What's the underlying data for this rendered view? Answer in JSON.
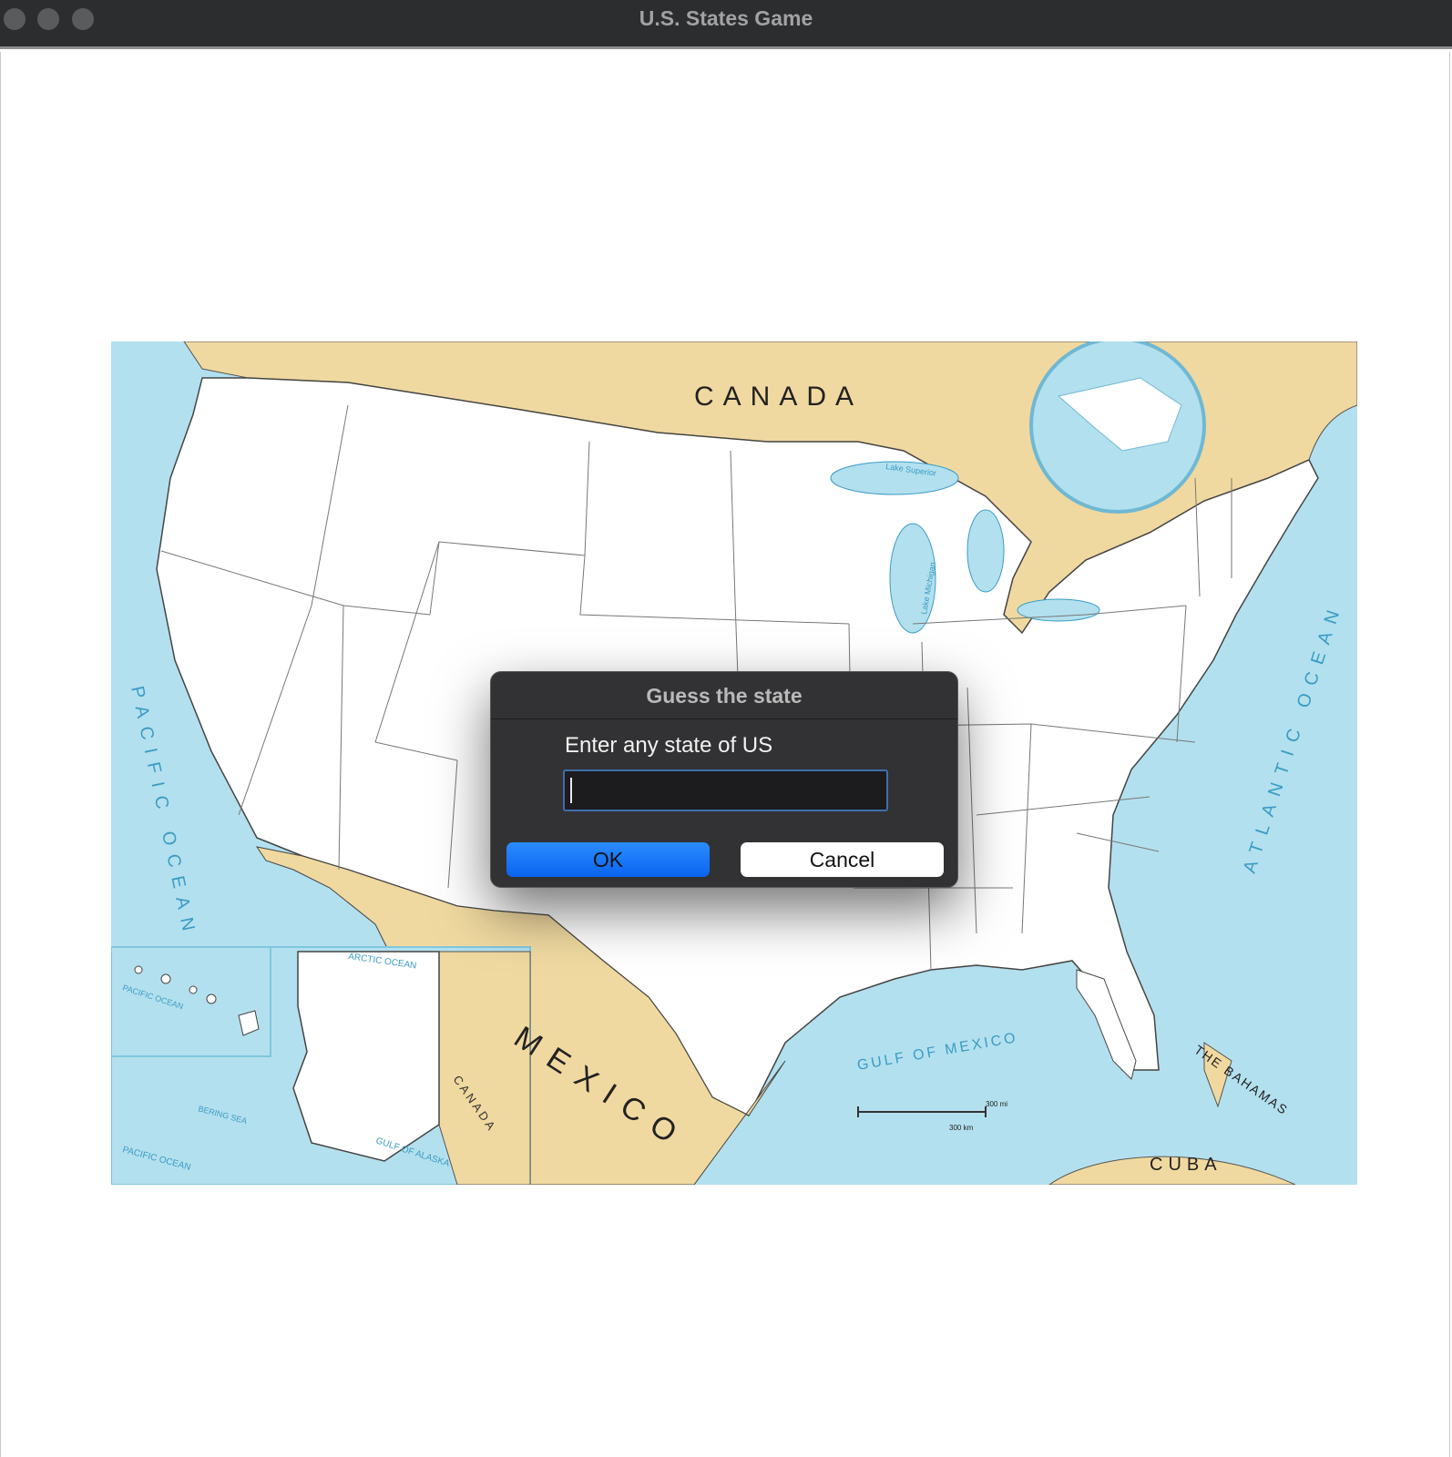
{
  "window": {
    "title": "U.S. States Game"
  },
  "map": {
    "labels": {
      "canada": "CANADA",
      "canada_alaska": "CANADA",
      "mexico": "MEXICO",
      "pacific": "PACIFIC OCEAN",
      "atlantic": "ATLANTIC OCEAN",
      "gulf_mexico": "GULF OF MEXICO",
      "gulf_alaska": "GULF OF ALASKA",
      "arctic": "ARCTIC OCEAN",
      "bering": "BERING SEA",
      "pacific_inset_hawaii": "PACIFIC OCEAN",
      "pacific_inset_alaska": "PACIFIC OCEAN",
      "bahamas": "THE BAHAMAS",
      "cuba": "CUBA",
      "lake_michigan": "Lake Michigan",
      "lake_superior": "Lake Superior",
      "scale_mi": "300 mi",
      "scale_km": "300 km"
    },
    "colors": {
      "water": "#b3e0ee",
      "foreign_land": "#f0d9a0",
      "us_land": "#ffffff",
      "border": "#555555"
    }
  },
  "dialog": {
    "title": "Guess the state",
    "prompt": "Enter any state of US",
    "input_value": "",
    "ok_label": "OK",
    "cancel_label": "Cancel"
  }
}
